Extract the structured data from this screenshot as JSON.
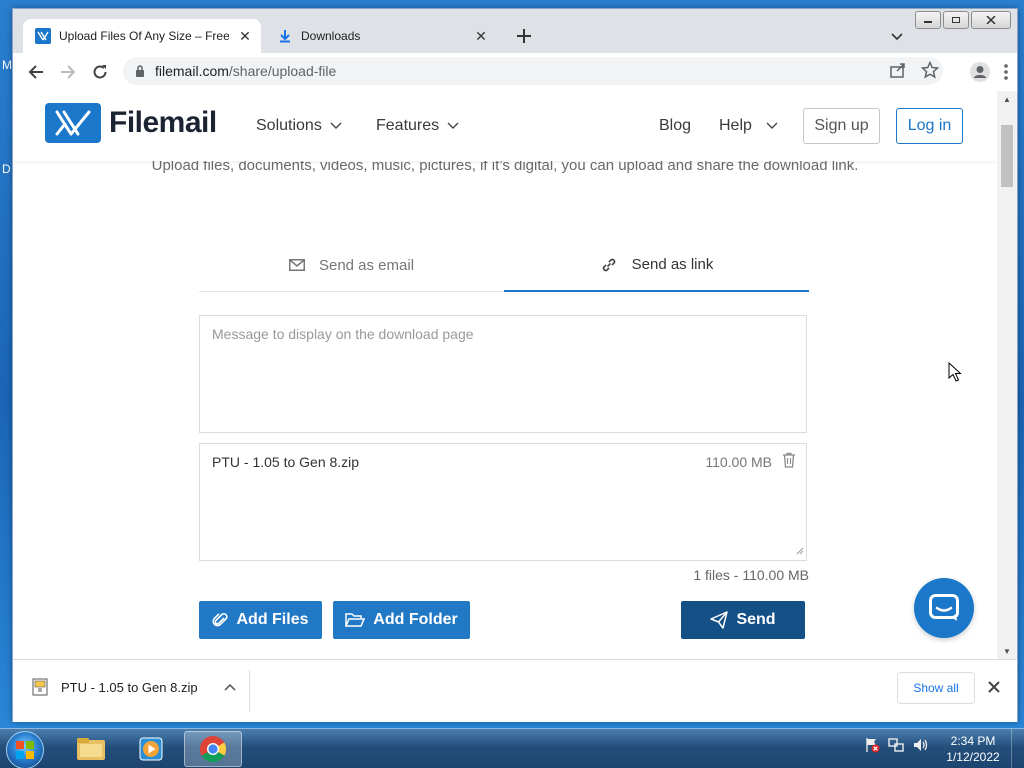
{
  "desktop": {
    "edge_letters": [
      "M",
      "D"
    ]
  },
  "browser": {
    "tabs": [
      {
        "title": "Upload Files Of Any Size – Free Upload",
        "active": true,
        "icon": "filemail-favicon"
      },
      {
        "title": "Downloads",
        "active": false,
        "icon": "download-icon"
      }
    ],
    "url_host": "filemail.com",
    "url_path": "/share/upload-file"
  },
  "site": {
    "logo_text": "Filemail",
    "nav": {
      "solutions": "Solutions",
      "features": "Features",
      "blog": "Blog",
      "help": "Help",
      "signup": "Sign up",
      "login": "Log in"
    },
    "subtitle": "Upload files, documents, videos, music, pictures, if it’s digital, you can upload and share the download link.",
    "send_tabs": {
      "email": "Send as email",
      "link": "Send as link",
      "active": "link"
    },
    "message_placeholder": "Message to display on the download page",
    "files": [
      {
        "name": "PTU - 1.05 to Gen 8.zip",
        "size": "110.00 MB"
      }
    ],
    "summary": "1 files - 110.00 MB",
    "buttons": {
      "add_files": "Add Files",
      "add_folder": "Add Folder",
      "send": "Send"
    },
    "colors": {
      "brand_blue": "#1a77c9",
      "send_dark": "#144f86"
    }
  },
  "download_shelf": {
    "file": "PTU - 1.05 to Gen 8.zip",
    "show_all": "Show all"
  },
  "taskbar": {
    "time": "2:34 PM",
    "date": "1/12/2022",
    "apps": [
      "windows-explorer-icon",
      "media-player-icon",
      "chrome-icon"
    ]
  }
}
